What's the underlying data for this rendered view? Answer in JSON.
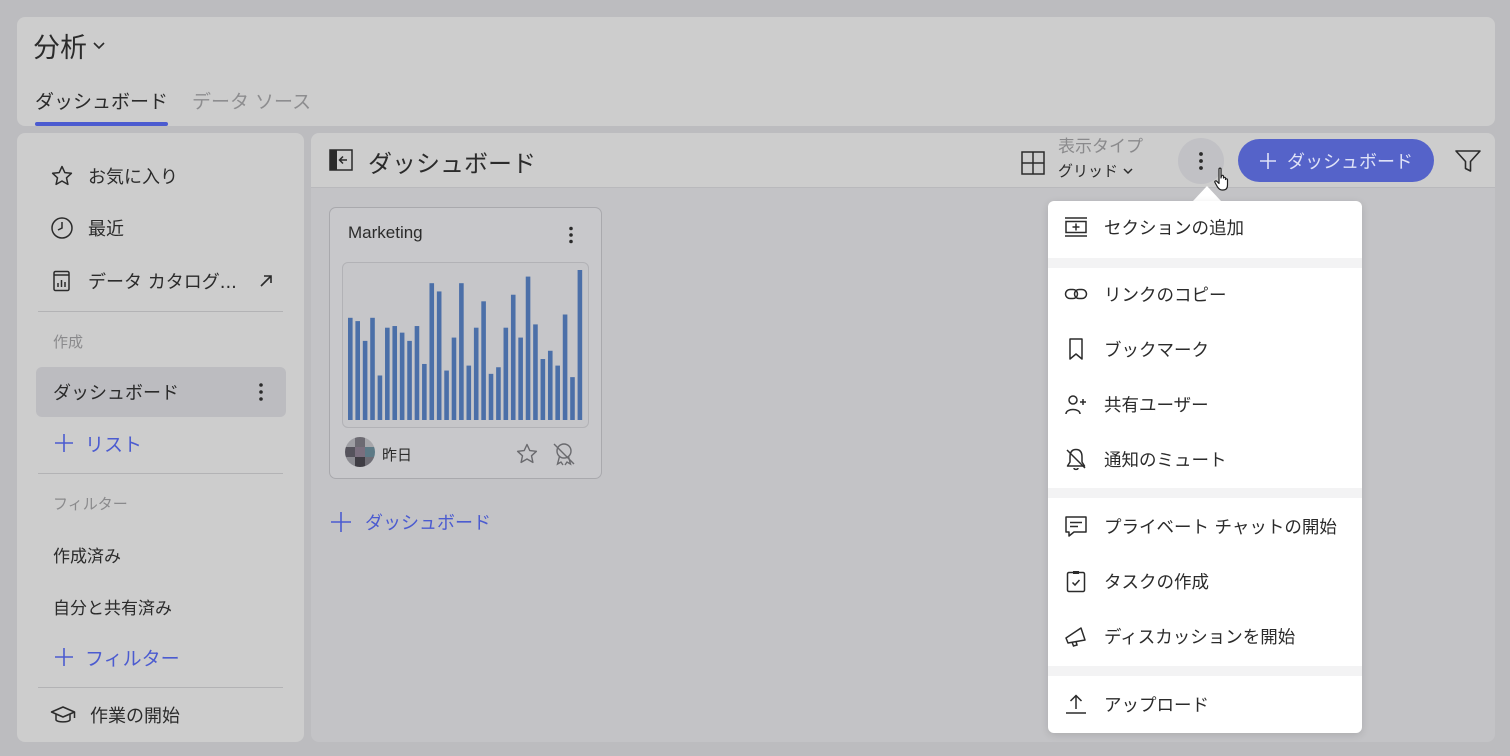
{
  "app": {
    "title": "分析"
  },
  "tabs": [
    {
      "label": "ダッシュボード",
      "active": true
    },
    {
      "label": "データ ソース",
      "active": false
    }
  ],
  "sidebar": {
    "items": [
      {
        "label": "お気に入り",
        "icon": "star-icon"
      },
      {
        "label": "最近",
        "icon": "clock-icon"
      },
      {
        "label": "データ カタログ...",
        "icon": "catalog-icon"
      }
    ],
    "create_label": "作成",
    "active_item": "ダッシュボード",
    "add_list": "リスト",
    "filter_label": "フィルター",
    "filters": [
      "作成済み",
      "自分と共有済み"
    ],
    "add_filter": "フィルター",
    "get_started": "作業の開始"
  },
  "main": {
    "title": "ダッシュボード",
    "view_type_label": "表示タイプ",
    "view_type_value": "グリッド",
    "add_dashboard_button": "ダッシュボード",
    "add_dashboard_link": "ダッシュボード"
  },
  "card": {
    "title": "Marketing",
    "updated": "昨日",
    "chart_data": {
      "type": "bar",
      "values": [
        62,
        60,
        48,
        62,
        27,
        56,
        57,
        53,
        48,
        57,
        34,
        83,
        78,
        30,
        50,
        83,
        33,
        56,
        72,
        28,
        32,
        56,
        76,
        50,
        87,
        58,
        37,
        42,
        33,
        64,
        26,
        91
      ],
      "color": "#4b6fa8"
    }
  },
  "menu": {
    "groups": [
      [
        {
          "label": "セクションの追加",
          "icon": "add-section-icon"
        }
      ],
      [
        {
          "label": "リンクのコピー",
          "icon": "link-icon"
        },
        {
          "label": "ブックマーク",
          "icon": "bookmark-icon"
        },
        {
          "label": "共有ユーザー",
          "icon": "share-user-icon"
        },
        {
          "label": "通知のミュート",
          "icon": "mute-bell-icon"
        }
      ],
      [
        {
          "label": "プライベート チャットの開始",
          "icon": "chat-icon"
        },
        {
          "label": "タスクの作成",
          "icon": "task-icon"
        },
        {
          "label": "ディスカッションを開始",
          "icon": "megaphone-icon"
        }
      ],
      [
        {
          "label": "アップロード",
          "icon": "upload-icon"
        }
      ]
    ]
  },
  "colors": {
    "accent": "#4b5bd0",
    "button": "#5563c9",
    "bar": "#4b6fa8"
  }
}
